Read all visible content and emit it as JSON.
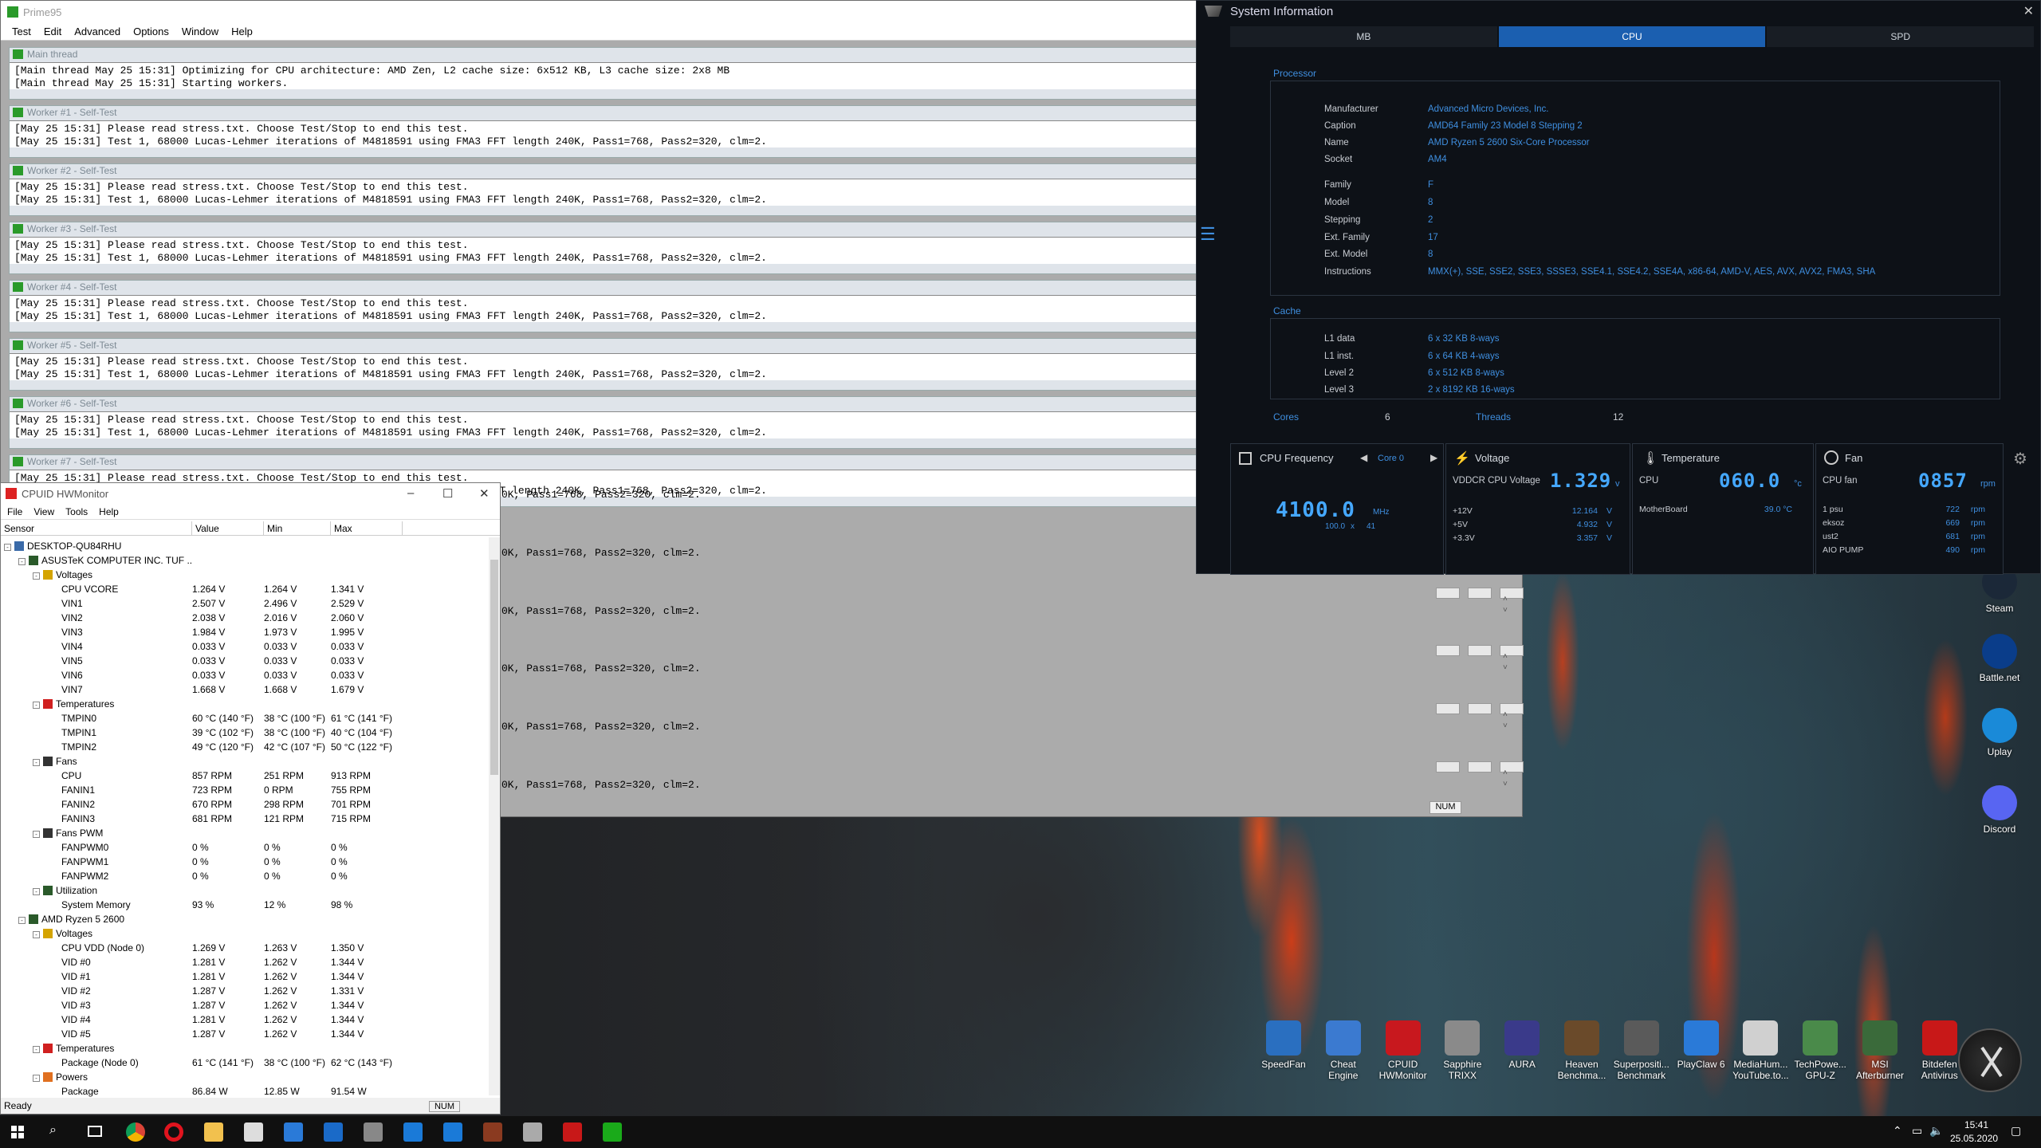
{
  "prime95": {
    "title": "Prime95",
    "menu": [
      "Test",
      "Edit",
      "Advanced",
      "Options",
      "Window",
      "Help"
    ],
    "workers": [
      {
        "title": "Main thread",
        "lines": [
          "[Main thread May 25 15:31] Optimizing for CPU architecture: AMD Zen, L2 cache size: 6x512 KB, L3 cache size: 2x8 MB",
          "[Main thread May 25 15:31] Starting workers."
        ]
      },
      {
        "title": "Worker #1 - Self-Test",
        "lines": [
          "[May 25 15:31] Please read stress.txt.  Choose Test/Stop to end this test.",
          "[May 25 15:31] Test 1, 68000 Lucas-Lehmer iterations of M4818591 using FMA3 FFT length 240K, Pass1=768, Pass2=320, clm=2."
        ]
      },
      {
        "title": "Worker #2 - Self-Test",
        "lines": [
          "[May 25 15:31] Please read stress.txt.  Choose Test/Stop to end this test.",
          "[May 25 15:31] Test 1, 68000 Lucas-Lehmer iterations of M4818591 using FMA3 FFT length 240K, Pass1=768, Pass2=320, clm=2."
        ]
      },
      {
        "title": "Worker #3 - Self-Test",
        "lines": [
          "[May 25 15:31] Please read stress.txt.  Choose Test/Stop to end this test.",
          "[May 25 15:31] Test 1, 68000 Lucas-Lehmer iterations of M4818591 using FMA3 FFT length 240K, Pass1=768, Pass2=320, clm=2."
        ]
      },
      {
        "title": "Worker #4 - Self-Test",
        "lines": [
          "[May 25 15:31] Please read stress.txt.  Choose Test/Stop to end this test.",
          "[May 25 15:31] Test 1, 68000 Lucas-Lehmer iterations of M4818591 using FMA3 FFT length 240K, Pass1=768, Pass2=320, clm=2."
        ]
      },
      {
        "title": "Worker #5 - Self-Test",
        "lines": [
          "[May 25 15:31] Please read stress.txt.  Choose Test/Stop to end this test.",
          "[May 25 15:31] Test 1, 68000 Lucas-Lehmer iterations of M4818591 using FMA3 FFT length 240K, Pass1=768, Pass2=320, clm=2."
        ]
      },
      {
        "title": "Worker #6 - Self-Test",
        "lines": [
          "[May 25 15:31] Please read stress.txt.  Choose Test/Stop to end this test.",
          "[May 25 15:31] Test 1, 68000 Lucas-Lehmer iterations of M4818591 using FMA3 FFT length 240K, Pass1=768, Pass2=320, clm=2."
        ]
      },
      {
        "title": "Worker #7 - Self-Test",
        "lines": [
          "[May 25 15:31] Please read stress.txt.  Choose Test/Stop to end this test.",
          "[May 25 15:31] Test 1, 68000 Lucas-Lehmer iterations of M4818591 using FMA3 FFT length 240K, Pass1=768, Pass2=320, clm=2."
        ]
      }
    ],
    "tail_line": "0K, Pass1=768, Pass2=320, clm=2.",
    "status_num": "NUM"
  },
  "hwmonitor": {
    "title": "CPUID HWMonitor",
    "menu": [
      "File",
      "View",
      "Tools",
      "Help"
    ],
    "columns": [
      "Sensor",
      "Value",
      "Min",
      "Max"
    ],
    "rows": [
      {
        "lvl": 0,
        "tog": "-",
        "label": "DESKTOP-QU84RHU",
        "v": "",
        "mn": "",
        "mx": "",
        "ic": "pc"
      },
      {
        "lvl": 1,
        "tog": "-",
        "label": "ASUSTeK COMPUTER INC. TUF ...",
        "v": "",
        "mn": "",
        "mx": "",
        "ic": "board"
      },
      {
        "lvl": 2,
        "tog": "-",
        "label": "Voltages",
        "v": "",
        "mn": "",
        "mx": "",
        "ic": "volt"
      },
      {
        "lvl": 3,
        "label": "CPU VCORE",
        "v": "1.264 V",
        "mn": "1.264 V",
        "mx": "1.341 V"
      },
      {
        "lvl": 3,
        "label": "VIN1",
        "v": "2.507 V",
        "mn": "2.496 V",
        "mx": "2.529 V"
      },
      {
        "lvl": 3,
        "label": "VIN2",
        "v": "2.038 V",
        "mn": "2.016 V",
        "mx": "2.060 V"
      },
      {
        "lvl": 3,
        "label": "VIN3",
        "v": "1.984 V",
        "mn": "1.973 V",
        "mx": "1.995 V"
      },
      {
        "lvl": 3,
        "label": "VIN4",
        "v": "0.033 V",
        "mn": "0.033 V",
        "mx": "0.033 V"
      },
      {
        "lvl": 3,
        "label": "VIN5",
        "v": "0.033 V",
        "mn": "0.033 V",
        "mx": "0.033 V"
      },
      {
        "lvl": 3,
        "label": "VIN6",
        "v": "0.033 V",
        "mn": "0.033 V",
        "mx": "0.033 V"
      },
      {
        "lvl": 3,
        "label": "VIN7",
        "v": "1.668 V",
        "mn": "1.668 V",
        "mx": "1.679 V"
      },
      {
        "lvl": 2,
        "tog": "-",
        "label": "Temperatures",
        "v": "",
        "mn": "",
        "mx": "",
        "ic": "temp"
      },
      {
        "lvl": 3,
        "label": "TMPIN0",
        "v": "60 °C  (140 °F)",
        "mn": "38 °C  (100 °F)",
        "mx": "61 °C  (141 °F)"
      },
      {
        "lvl": 3,
        "label": "TMPIN1",
        "v": "39 °C  (102 °F)",
        "mn": "38 °C  (100 °F)",
        "mx": "40 °C  (104 °F)"
      },
      {
        "lvl": 3,
        "label": "TMPIN2",
        "v": "49 °C  (120 °F)",
        "mn": "42 °C  (107 °F)",
        "mx": "50 °C  (122 °F)"
      },
      {
        "lvl": 2,
        "tog": "-",
        "label": "Fans",
        "v": "",
        "mn": "",
        "mx": "",
        "ic": "fan"
      },
      {
        "lvl": 3,
        "label": "CPU",
        "v": "857 RPM",
        "mn": "251 RPM",
        "mx": "913 RPM"
      },
      {
        "lvl": 3,
        "label": "FANIN1",
        "v": "723 RPM",
        "mn": "0 RPM",
        "mx": "755 RPM"
      },
      {
        "lvl": 3,
        "label": "FANIN2",
        "v": "670 RPM",
        "mn": "298 RPM",
        "mx": "701 RPM"
      },
      {
        "lvl": 3,
        "label": "FANIN3",
        "v": "681 RPM",
        "mn": "121 RPM",
        "mx": "715 RPM"
      },
      {
        "lvl": 2,
        "tog": "-",
        "label": "Fans PWM",
        "v": "",
        "mn": "",
        "mx": "",
        "ic": "fan"
      },
      {
        "lvl": 3,
        "label": "FANPWM0",
        "v": "0 %",
        "mn": "0 %",
        "mx": "0 %"
      },
      {
        "lvl": 3,
        "label": "FANPWM1",
        "v": "0 %",
        "mn": "0 %",
        "mx": "0 %"
      },
      {
        "lvl": 3,
        "label": "FANPWM2",
        "v": "0 %",
        "mn": "0 %",
        "mx": "0 %"
      },
      {
        "lvl": 2,
        "tog": "-",
        "label": "Utilization",
        "v": "",
        "mn": "",
        "mx": "",
        "ic": "util"
      },
      {
        "lvl": 3,
        "label": "System Memory",
        "v": "93 %",
        "mn": "12 %",
        "mx": "98 %"
      },
      {
        "lvl": 1,
        "tog": "-",
        "label": "AMD Ryzen 5 2600",
        "v": "",
        "mn": "",
        "mx": "",
        "ic": "board"
      },
      {
        "lvl": 2,
        "tog": "-",
        "label": "Voltages",
        "v": "",
        "mn": "",
        "mx": "",
        "ic": "volt"
      },
      {
        "lvl": 3,
        "label": "CPU VDD (Node 0)",
        "v": "1.269 V",
        "mn": "1.263 V",
        "mx": "1.350 V"
      },
      {
        "lvl": 3,
        "label": "VID #0",
        "v": "1.281 V",
        "mn": "1.262 V",
        "mx": "1.344 V"
      },
      {
        "lvl": 3,
        "label": "VID #1",
        "v": "1.281 V",
        "mn": "1.262 V",
        "mx": "1.344 V"
      },
      {
        "lvl": 3,
        "label": "VID #2",
        "v": "1.287 V",
        "mn": "1.262 V",
        "mx": "1.331 V"
      },
      {
        "lvl": 3,
        "label": "VID #3",
        "v": "1.287 V",
        "mn": "1.262 V",
        "mx": "1.344 V"
      },
      {
        "lvl": 3,
        "label": "VID #4",
        "v": "1.281 V",
        "mn": "1.262 V",
        "mx": "1.344 V"
      },
      {
        "lvl": 3,
        "label": "VID #5",
        "v": "1.287 V",
        "mn": "1.262 V",
        "mx": "1.344 V"
      },
      {
        "lvl": 2,
        "tog": "-",
        "label": "Temperatures",
        "v": "",
        "mn": "",
        "mx": "",
        "ic": "temp"
      },
      {
        "lvl": 3,
        "label": "Package (Node 0)",
        "v": "61 °C  (141 °F)",
        "mn": "38 °C  (100 °F)",
        "mx": "62 °C  (143 °F)"
      },
      {
        "lvl": 2,
        "tog": "-",
        "label": "Powers",
        "v": "",
        "mn": "",
        "mx": "",
        "ic": "power"
      },
      {
        "lvl": 3,
        "label": "Package",
        "v": "86.84 W",
        "mn": "12.85 W",
        "mx": "91.54 W"
      }
    ],
    "status": "Ready",
    "num": "NUM"
  },
  "sysinfo": {
    "title": "System Information",
    "tabs": [
      "MB",
      "CPU",
      "SPD"
    ],
    "active_tab": "CPU",
    "processor_label": "Processor",
    "processor": [
      {
        "k": "Manufacturer",
        "v": "Advanced Micro Devices, Inc."
      },
      {
        "k": "Caption",
        "v": "AMD64 Family 23 Model 8 Stepping 2"
      },
      {
        "k": "Name",
        "v": "AMD Ryzen 5 2600 Six-Core Processor"
      },
      {
        "k": "Socket",
        "v": "AM4"
      },
      {
        "k": "Family",
        "v": "F"
      },
      {
        "k": "Model",
        "v": "8"
      },
      {
        "k": "Stepping",
        "v": "2"
      },
      {
        "k": "Ext. Family",
        "v": "17"
      },
      {
        "k": "Ext. Model",
        "v": "8"
      },
      {
        "k": "Instructions",
        "v": "MMX(+), SSE, SSE2, SSE3, SSSE3, SSE4.1, SSE4.2, SSE4A, x86-64, AMD-V, AES, AVX, AVX2, FMA3, SHA"
      }
    ],
    "cache_label": "Cache",
    "cache": [
      {
        "k": "L1 data",
        "v": "6 x 32 KB 8-ways"
      },
      {
        "k": "L1 inst.",
        "v": "6 x 64 KB 4-ways"
      },
      {
        "k": "Level 2",
        "v": "6 x 512 KB 8-ways"
      },
      {
        "k": "Level 3",
        "v": "2 x 8192 KB 16-ways"
      }
    ],
    "cores_label": "Cores",
    "cores": "6",
    "threads_label": "Threads",
    "threads": "12",
    "freq": {
      "label": "CPU Frequency",
      "core": "Core 0",
      "value": "4100.0",
      "unit": "MHz",
      "mult_a": "100.0",
      "x": "x",
      "mult_b": "41"
    },
    "voltage": {
      "label": "Voltage",
      "name": "VDDCR CPU Voltage",
      "value": "1.329",
      "unit": "v",
      "rows": [
        {
          "k": "+12V",
          "v": "12.164",
          "u": "V"
        },
        {
          "k": "+5V",
          "v": "4.932",
          "u": "V"
        },
        {
          "k": "+3.3V",
          "v": "3.357",
          "u": "V"
        }
      ]
    },
    "temp": {
      "label": "Temperature",
      "name": "CPU",
      "value": "060.0",
      "unit": "°c",
      "mb": "MotherBoard",
      "mbv": "39.0 °C"
    },
    "fan": {
      "label": "Fan",
      "name": "CPU fan",
      "value": "0857",
      "unit": "rpm",
      "rows": [
        {
          "k": "1 psu",
          "v": "722",
          "u": "rpm"
        },
        {
          "k": "eksoz",
          "v": "669",
          "u": "rpm"
        },
        {
          "k": "ust2",
          "v": "681",
          "u": "rpm"
        },
        {
          "k": "AIO PUMP",
          "v": "490",
          "u": "rpm"
        }
      ]
    }
  },
  "desktop_icons": [
    {
      "label": "Steam",
      "color": "#1b2838"
    },
    {
      "label": "Battle.net",
      "color": "#0a3d8a"
    },
    {
      "label": "Uplay",
      "color": "#1a8ad8"
    },
    {
      "label": "Discord",
      "color": "#5865f2"
    }
  ],
  "bottom_icons": [
    {
      "label": "SpeedFan",
      "color": "#2a6fc0"
    },
    {
      "label": "Cheat Engine",
      "color": "#3b7ad0"
    },
    {
      "label": "CPUID HWMonitor",
      "color": "#c8181e"
    },
    {
      "label": "Sapphire TRIXX",
      "color": "#8a8a8a"
    },
    {
      "label": "AURA",
      "color": "#3a3a8a"
    },
    {
      "label": "Heaven Benchma...",
      "color": "#6a4a2a"
    },
    {
      "label": "Superpositi... Benchmark",
      "color": "#5a5a5a"
    },
    {
      "label": "PlayClaw 6",
      "color": "#2a7ad8"
    },
    {
      "label": "MediaHum... YouTube.to...",
      "color": "#d0d0d0"
    },
    {
      "label": "TechPowe... GPU-Z",
      "color": "#4a8a4a"
    },
    {
      "label": "MSI Afterburner",
      "color": "#3a6a3a"
    },
    {
      "label": "Bitdefen Antivirus",
      "color": "#c81818"
    }
  ],
  "taskbar": {
    "time": "15:41",
    "date": "25.05.2020"
  }
}
